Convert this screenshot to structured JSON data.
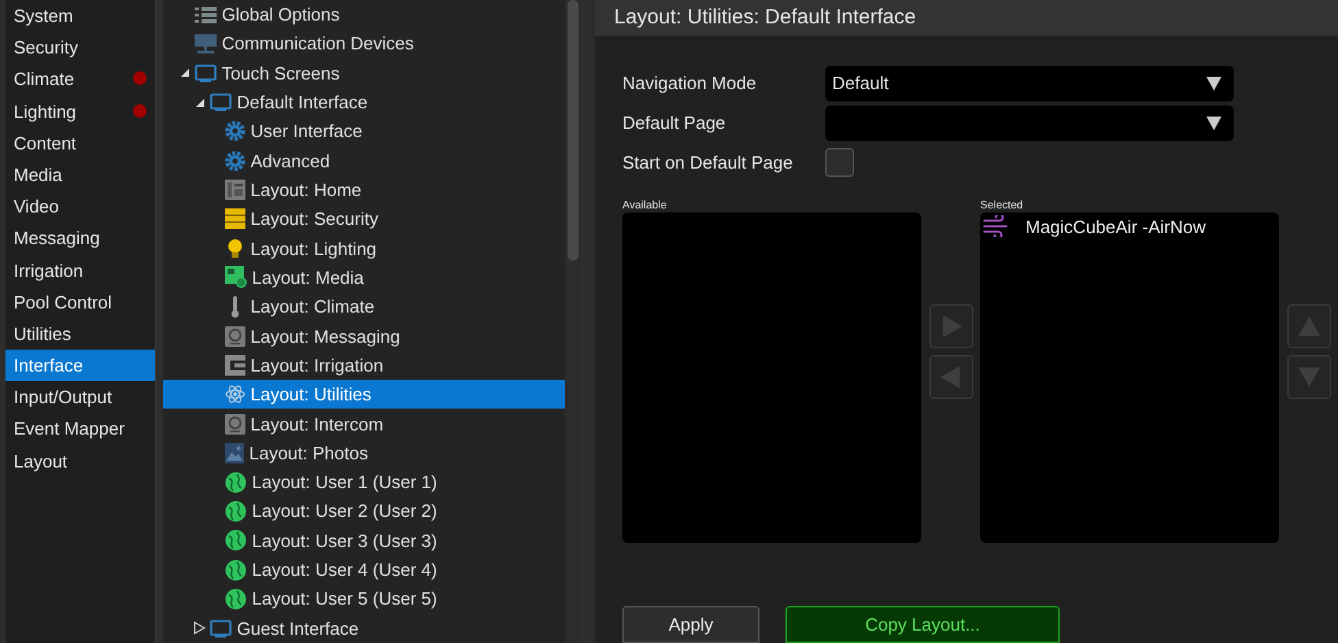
{
  "nav": {
    "items": [
      {
        "label": "System",
        "selected": false,
        "alert": false
      },
      {
        "label": "Security",
        "selected": false,
        "alert": false
      },
      {
        "label": "Climate",
        "selected": false,
        "alert": true
      },
      {
        "label": "Lighting",
        "selected": false,
        "alert": true
      },
      {
        "label": "Content",
        "selected": false,
        "alert": false
      },
      {
        "label": "Media",
        "selected": false,
        "alert": false
      },
      {
        "label": "Video",
        "selected": false,
        "alert": false
      },
      {
        "label": "Messaging",
        "selected": false,
        "alert": false
      },
      {
        "label": "Irrigation",
        "selected": false,
        "alert": false
      },
      {
        "label": "Pool Control",
        "selected": false,
        "alert": false
      },
      {
        "label": "Utilities",
        "selected": false,
        "alert": false
      },
      {
        "label": "Interface",
        "selected": true,
        "alert": false
      },
      {
        "label": "Input/Output",
        "selected": false,
        "alert": false
      },
      {
        "label": "Event Mapper",
        "selected": false,
        "alert": false
      },
      {
        "label": "Layout",
        "selected": false,
        "alert": false
      }
    ]
  },
  "tree": {
    "items": [
      {
        "label": "Global Options",
        "kind": "list",
        "selected": false
      },
      {
        "label": "Communication Devices",
        "kind": "server",
        "selected": false
      },
      {
        "label": "Touch Screens",
        "kind": "monitor",
        "selected": false,
        "expanded": true,
        "children": [
          {
            "label": "Default Interface",
            "kind": "monitor",
            "selected": false,
            "expanded": true,
            "children": [
              {
                "label": "User Interface",
                "kind": "gear",
                "selected": false
              },
              {
                "label": "Advanced",
                "kind": "gear",
                "selected": false
              },
              {
                "label": "Layout: Home",
                "kind": "phone",
                "selected": false
              },
              {
                "label": "Layout: Security",
                "kind": "cabinet",
                "selected": false
              },
              {
                "label": "Layout: Lighting",
                "kind": "bulb",
                "selected": false
              },
              {
                "label": "Layout: Media",
                "kind": "media",
                "selected": false
              },
              {
                "label": "Layout: Climate",
                "kind": "thermometer",
                "selected": false
              },
              {
                "label": "Layout: Messaging",
                "kind": "intercom",
                "selected": false
              },
              {
                "label": "Layout: Irrigation",
                "kind": "irrigation",
                "selected": false
              },
              {
                "label": "Layout: Utilities",
                "kind": "atom",
                "selected": true
              },
              {
                "label": "Layout: Intercom",
                "kind": "intercom",
                "selected": false
              },
              {
                "label": "Layout: Photos",
                "kind": "photo",
                "selected": false
              },
              {
                "label": "Layout: User 1 (User 1)",
                "kind": "globe",
                "selected": false
              },
              {
                "label": "Layout: User 2 (User 2)",
                "kind": "globe",
                "selected": false
              },
              {
                "label": "Layout: User 3 (User 3)",
                "kind": "globe",
                "selected": false
              },
              {
                "label": "Layout: User 4 (User 4)",
                "kind": "globe",
                "selected": false
              },
              {
                "label": "Layout: User 5 (User 5)",
                "kind": "globe",
                "selected": false
              }
            ]
          },
          {
            "label": "Guest Interface",
            "kind": "monitor",
            "selected": false,
            "expanded": false
          }
        ]
      }
    ]
  },
  "panel": {
    "title": "Layout: Utilities: Default Interface",
    "navigation_mode": {
      "label": "Navigation Mode",
      "value": "Default"
    },
    "default_page": {
      "label": "Default Page"
    },
    "start_on_default": {
      "label": "Start on Default Page",
      "checked": false
    },
    "available": {
      "label": "Available"
    },
    "selected": {
      "label": "Selected",
      "items": [
        {
          "label": "MagicCubeAir -AirNow",
          "kind": "wind"
        }
      ]
    },
    "buttons": [
      {
        "label": "Apply",
        "kind": "plain"
      },
      {
        "label": "Copy Layout...",
        "kind": "primary"
      }
    ]
  }
}
